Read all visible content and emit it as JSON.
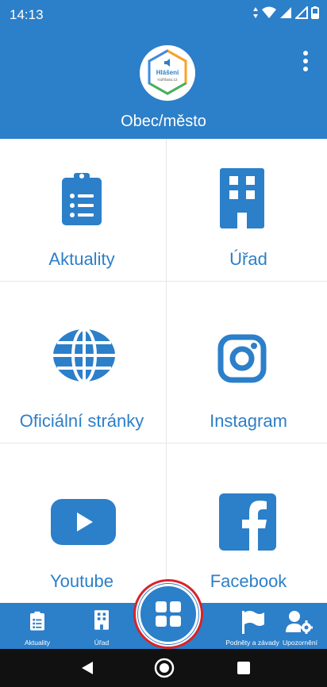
{
  "status_bar": {
    "time": "14:13"
  },
  "header": {
    "logo_text_main": "Hlášení",
    "logo_text_sub": "rozhlasu.cz",
    "title": "Obec/město"
  },
  "tiles": [
    {
      "label": "Aktuality",
      "icon": "clipboard-list-icon"
    },
    {
      "label": "Úřad",
      "icon": "building-icon"
    },
    {
      "label": "Oficiální stránky",
      "icon": "globe-icon"
    },
    {
      "label": "Instagram",
      "icon": "instagram-icon"
    },
    {
      "label": "Youtube",
      "icon": "youtube-icon"
    },
    {
      "label": "Facebook",
      "icon": "facebook-icon"
    }
  ],
  "bottom_nav": [
    {
      "label": "Aktuality",
      "icon": "clipboard-list-icon"
    },
    {
      "label": "Úřad",
      "icon": "building-icon"
    },
    {
      "label": "Podněty a závady",
      "icon": "flag-icon"
    },
    {
      "label": "Upozornění",
      "icon": "user-gear-icon"
    }
  ],
  "colors": {
    "primary": "#2c7fc9",
    "highlight_ring": "#d9232a",
    "divider": "#e6e6e6"
  }
}
